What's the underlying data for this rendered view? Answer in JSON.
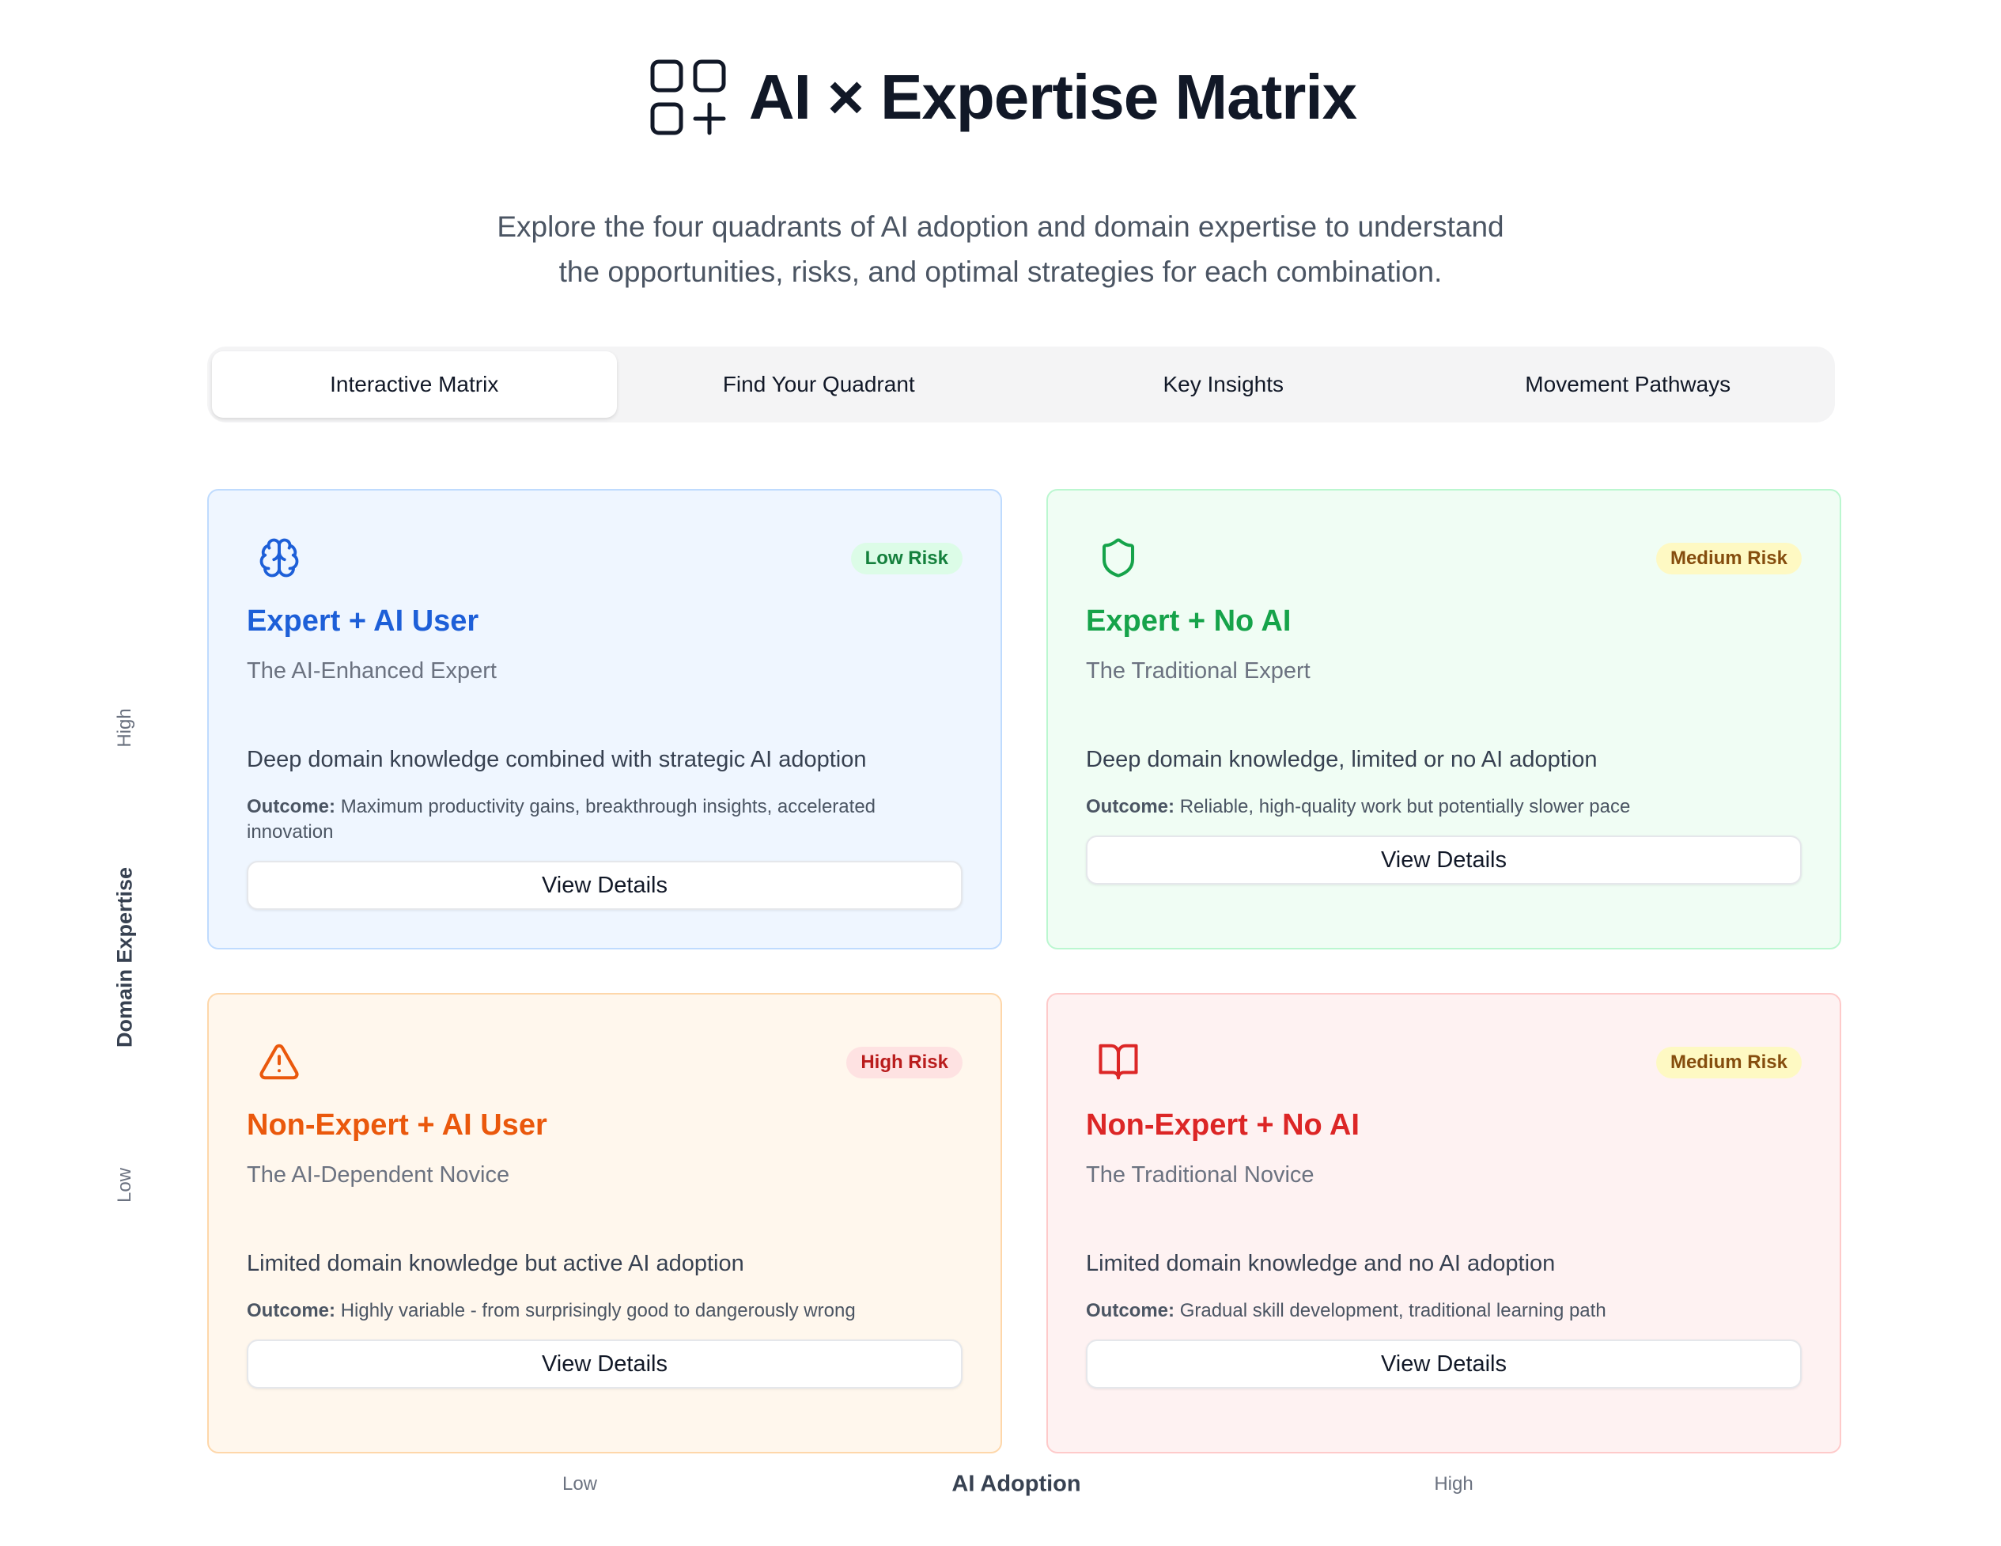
{
  "header": {
    "title": "AI × Expertise Matrix",
    "icon": "grid-plus-icon",
    "subtitle_line1": "Explore the four quadrants of AI adoption and domain expertise to understand",
    "subtitle_line2": "the opportunities, risks, and optimal strategies for each combination."
  },
  "tabs": [
    {
      "label": "Interactive Matrix",
      "active": true
    },
    {
      "label": "Find Your Quadrant",
      "active": false
    },
    {
      "label": "Key Insights",
      "active": false
    },
    {
      "label": "Movement Pathways",
      "active": false
    }
  ],
  "axes": {
    "y_name": "Domain Expertise",
    "y_high": "High",
    "y_low": "Low",
    "x_name": "AI Adoption",
    "x_low": "Low",
    "x_high": "High"
  },
  "quadrants": [
    {
      "icon": "brain-icon",
      "risk": "Low Risk",
      "title": "Expert + AI User",
      "subtitle": "The AI-Enhanced Expert",
      "description": "Deep domain knowledge combined with strategic AI adoption",
      "outcome_label": "Outcome:",
      "outcome": "Maximum productivity gains, breakthrough insights, accelerated innovation",
      "button": "View Details",
      "accent": "#1d5fd8",
      "badge_bg": "#dcfce7",
      "badge_fg": "#15803d"
    },
    {
      "icon": "shield-icon",
      "risk": "Medium Risk",
      "title": "Expert + No AI",
      "subtitle": "The Traditional Expert",
      "description": "Deep domain knowledge, limited or no AI adoption",
      "outcome_label": "Outcome:",
      "outcome": "Reliable, high-quality work but potentially slower pace",
      "button": "View Details",
      "accent": "#16a34a",
      "badge_bg": "#fef9c3",
      "badge_fg": "#854d0e"
    },
    {
      "icon": "warning-triangle-icon",
      "risk": "High Risk",
      "title": "Non-Expert + AI User",
      "subtitle": "The AI-Dependent Novice",
      "description": "Limited domain knowledge but active AI adoption",
      "outcome_label": "Outcome:",
      "outcome": "Highly variable - from surprisingly good to dangerously wrong",
      "button": "View Details",
      "accent": "#ea580c",
      "badge_bg": "#fee2e2",
      "badge_fg": "#b91c1c"
    },
    {
      "icon": "open-book-icon",
      "risk": "Medium Risk",
      "title": "Non-Expert + No AI",
      "subtitle": "The Traditional Novice",
      "description": "Limited domain knowledge and no AI adoption",
      "outcome_label": "Outcome:",
      "outcome": "Gradual skill development, traditional learning path",
      "button": "View Details",
      "accent": "#dc2626",
      "badge_bg": "#fef9c3",
      "badge_fg": "#854d0e"
    }
  ]
}
